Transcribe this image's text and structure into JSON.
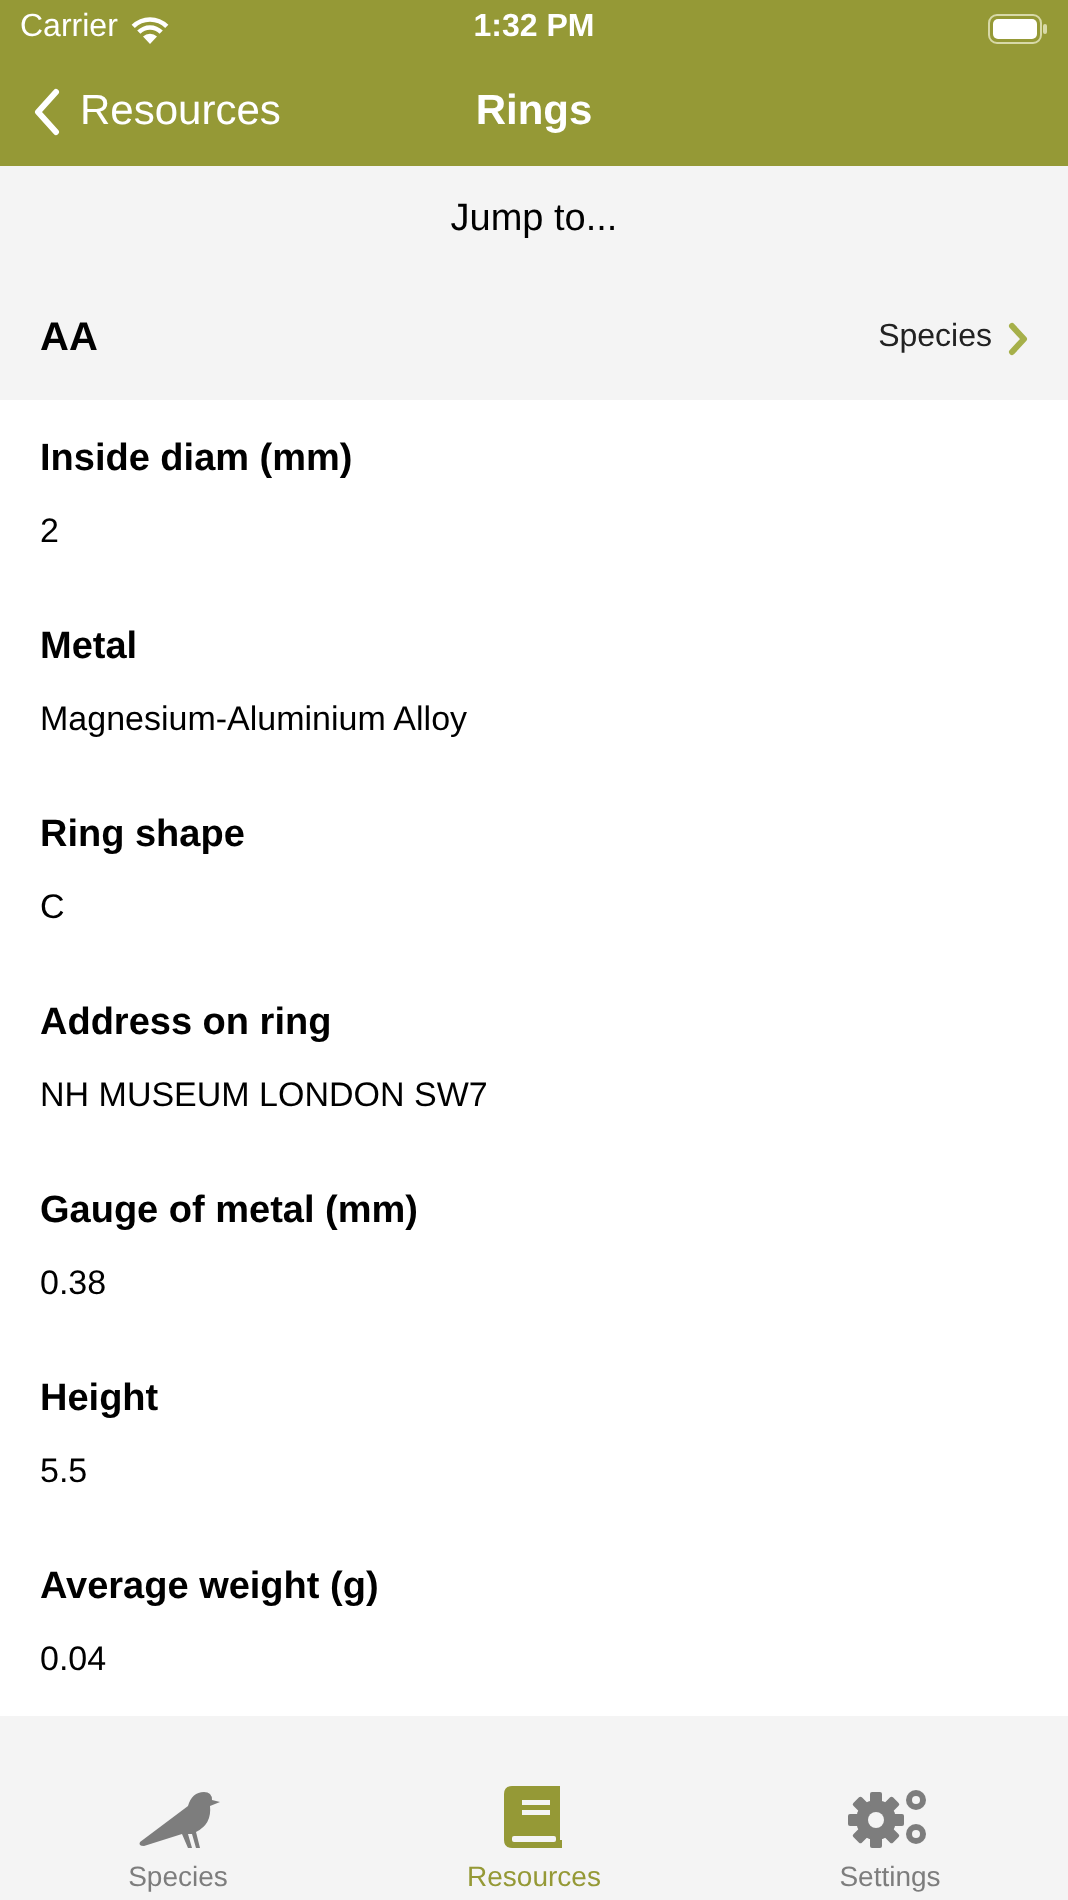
{
  "status_bar": {
    "carrier": "Carrier",
    "time": "1:32 PM"
  },
  "nav": {
    "back": "Resources",
    "title": "Rings"
  },
  "jump_to": "Jump to...",
  "section": {
    "title": "AA",
    "link": "Species"
  },
  "fields": [
    {
      "label": "Inside diam (mm)",
      "value": "2"
    },
    {
      "label": "Metal",
      "value": "Magnesium-Aluminium Alloy"
    },
    {
      "label": "Ring shape",
      "value": "C"
    },
    {
      "label": "Address on ring",
      "value": "NH MUSEUM LONDON SW7"
    },
    {
      "label": "Gauge of metal (mm)",
      "value": "0.38"
    },
    {
      "label": "Height",
      "value": "5.5"
    },
    {
      "label": "Average weight (g)",
      "value": "0.04"
    }
  ],
  "tab_bar": [
    {
      "label": "Species",
      "kind": "bird",
      "selected": false
    },
    {
      "label": "Resources",
      "kind": "book",
      "selected": true
    },
    {
      "label": "Settings",
      "kind": "gears",
      "selected": false
    }
  ]
}
